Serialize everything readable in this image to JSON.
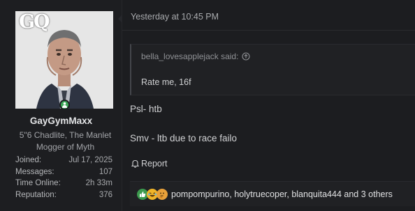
{
  "user": {
    "avatar_brand": "GQ",
    "username": "GayGymMaxx",
    "title_line1": "5\"6 Chadlite, The Manlet",
    "title_line2": "Mogger of Myth",
    "online": true,
    "stats": [
      {
        "label": "Joined:",
        "value": "Jul 17, 2025"
      },
      {
        "label": "Messages:",
        "value": "107"
      },
      {
        "label": "Time Online:",
        "value": "2h 33m"
      },
      {
        "label": "Reputation:",
        "value": "376"
      }
    ]
  },
  "post": {
    "timestamp": "Yesterday at 10:45 PM",
    "quote": {
      "author_said": "bella_lovesapplejack said:",
      "text": "Rate me, 16f"
    },
    "lines": [
      "Psl- htb",
      "Smv - ltb due to race failo"
    ],
    "report_label": "Report"
  },
  "reactions": {
    "icons": [
      "like-icon",
      "laugh-icon",
      "thinking-icon"
    ],
    "text": "pompompurino, holytruecoper, blanquita444 and 3 others"
  },
  "colors": {
    "background": "#17181b",
    "online": "#3aa655",
    "like": "#3c9a4e",
    "laugh": "#f0b429"
  }
}
